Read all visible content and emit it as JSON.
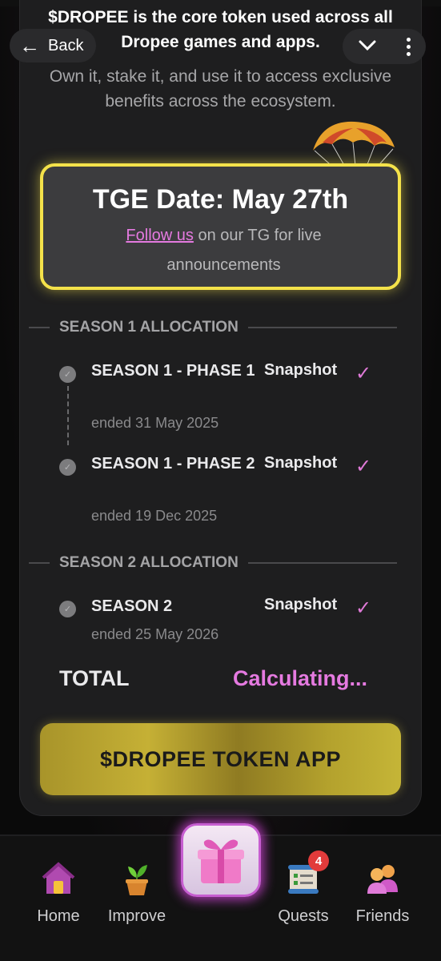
{
  "header": {
    "back_label": "Back",
    "back_icon": "arrow-left-icon",
    "collapse_icon": "chevron-down-icon",
    "menu_icon": "kebab-menu-icon"
  },
  "intro": {
    "line1": "$DROPEE is the core token used across all Dropee games and apps.",
    "line2": "Own it, stake it, and use it to access exclusive benefits across the ecosystem."
  },
  "tge": {
    "title": "TGE Date: May 27th",
    "link_text": "Follow us",
    "rest_text": " on our TG for live announcements",
    "border_color": "#f4e24a"
  },
  "season1": {
    "heading": "SEASON 1 ALLOCATION",
    "items": [
      {
        "title": "SEASON 1 - PHASE 1",
        "date": "ended 31 May 2025",
        "status": "Snapshot"
      },
      {
        "title": "SEASON 1 - PHASE 2",
        "date": "ended 19 Dec 2025",
        "status": "Snapshot"
      }
    ]
  },
  "season2": {
    "heading": "SEASON 2 ALLOCATION",
    "items": [
      {
        "title": "SEASON 2",
        "date": "ended 25 May 2026",
        "status": "Snapshot"
      }
    ]
  },
  "total": {
    "label": "TOTAL",
    "value": "Calculating...",
    "value_color": "#e57ae0"
  },
  "token_button": {
    "label": "$DROPEE TOKEN APP"
  },
  "nav": {
    "items": [
      {
        "label": "Home",
        "icon": "house-icon"
      },
      {
        "label": "Improve",
        "icon": "sprout-pot-icon"
      },
      {
        "label": "",
        "icon": "gift-icon"
      },
      {
        "label": "Quests",
        "icon": "scroll-checklist-icon",
        "badge": "4"
      },
      {
        "label": "Friends",
        "icon": "friends-icon"
      }
    ]
  }
}
